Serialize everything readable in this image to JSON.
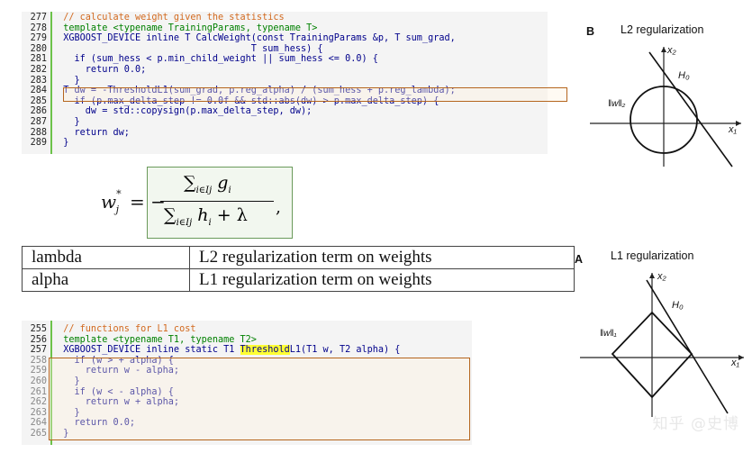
{
  "code_top": {
    "lines": [
      {
        "n": "277",
        "text": "  // calculate weight given the statistics",
        "cls": "cm"
      },
      {
        "n": "278",
        "text": "  template <typename TrainingParams, typename T>",
        "cls": "kw"
      },
      {
        "n": "279",
        "text": "  XGBOOST_DEVICE inline T CalcWeight(const TrainingParams &p, T sum_grad,",
        "cls": "txt"
      },
      {
        "n": "280",
        "text": "                                    T sum_hess) {",
        "cls": "txt"
      },
      {
        "n": "281",
        "text": "    if (sum_hess < p.min_child_weight || sum_hess <= 0.0) {",
        "cls": "txt"
      },
      {
        "n": "282",
        "text": "      return 0.0;",
        "cls": "txt"
      },
      {
        "n": "283",
        "text": "    }",
        "cls": "txt"
      },
      {
        "n": "284",
        "text": "  T dw = -ThresholdL1(sum_grad, p.reg_alpha) / (sum_hess + p.reg_lambda);",
        "cls": "txt"
      },
      {
        "n": "285",
        "text": "    if (p.max_delta_step != 0.0f && std::abs(dw) > p.max_delta_step) {",
        "cls": "txt"
      },
      {
        "n": "286",
        "text": "      dw = std::copysign(p.max_delta_step, dw);",
        "cls": "txt"
      },
      {
        "n": "287",
        "text": "    }",
        "cls": "txt"
      },
      {
        "n": "288",
        "text": "    return dw;",
        "cls": "txt"
      },
      {
        "n": "289",
        "text": "  }",
        "cls": "txt"
      }
    ]
  },
  "formula": {
    "lhs": "w",
    "lhs_sup": "*",
    "lhs_sub": "j",
    "eq": "= −",
    "numerator": "∑",
    "num_sub": "i∈Ij",
    "num_var": "g",
    "num_var_sub": "i",
    "denominator": "∑",
    "den_sub": "i∈Ij",
    "den_var": "h",
    "den_var_sub": "i",
    "den_plus": "+ λ",
    "trail": ","
  },
  "params_table": [
    {
      "name": "lambda",
      "desc": "L2 regularization term on weights"
    },
    {
      "name": "alpha",
      "desc": "L1 regularization term on weights"
    }
  ],
  "code_bottom": {
    "lines": [
      {
        "n": "255",
        "text": "  // functions for L1 cost",
        "cls": "cm"
      },
      {
        "n": "256",
        "text": "  template <typename T1, typename T2>",
        "cls": "kw"
      },
      {
        "n": "257",
        "pre": "  XGBOOST_DEVICE inline static T1 ",
        "mark": "Threshold",
        "post": "L1(T1 w, T2 alpha) {",
        "cls": "txt"
      },
      {
        "n": "258",
        "text": "    if (w > + alpha) {",
        "cls": "txt"
      },
      {
        "n": "259",
        "text": "      return w - alpha;",
        "cls": "txt"
      },
      {
        "n": "260",
        "text": "    }",
        "cls": "txt"
      },
      {
        "n": "261",
        "text": "    if (w < - alpha) {",
        "cls": "txt"
      },
      {
        "n": "262",
        "text": "      return w + alpha;",
        "cls": "txt"
      },
      {
        "n": "263",
        "text": "    }",
        "cls": "txt"
      },
      {
        "n": "264",
        "text": "    return 0.0;",
        "cls": "txt"
      },
      {
        "n": "265",
        "text": "  }",
        "cls": "txt"
      }
    ]
  },
  "fig_l2": {
    "letter": "B",
    "title": "L2 regularization",
    "x1": "x₁",
    "x2": "x₂",
    "h0": "H₀",
    "norm": "‖w‖₂"
  },
  "fig_l1": {
    "letter": "A",
    "title": "L1 regularization",
    "x1": "x₁",
    "x2": "x₂",
    "h0": "H₀",
    "norm": "‖w‖₁"
  },
  "watermark": "知乎 @史博"
}
